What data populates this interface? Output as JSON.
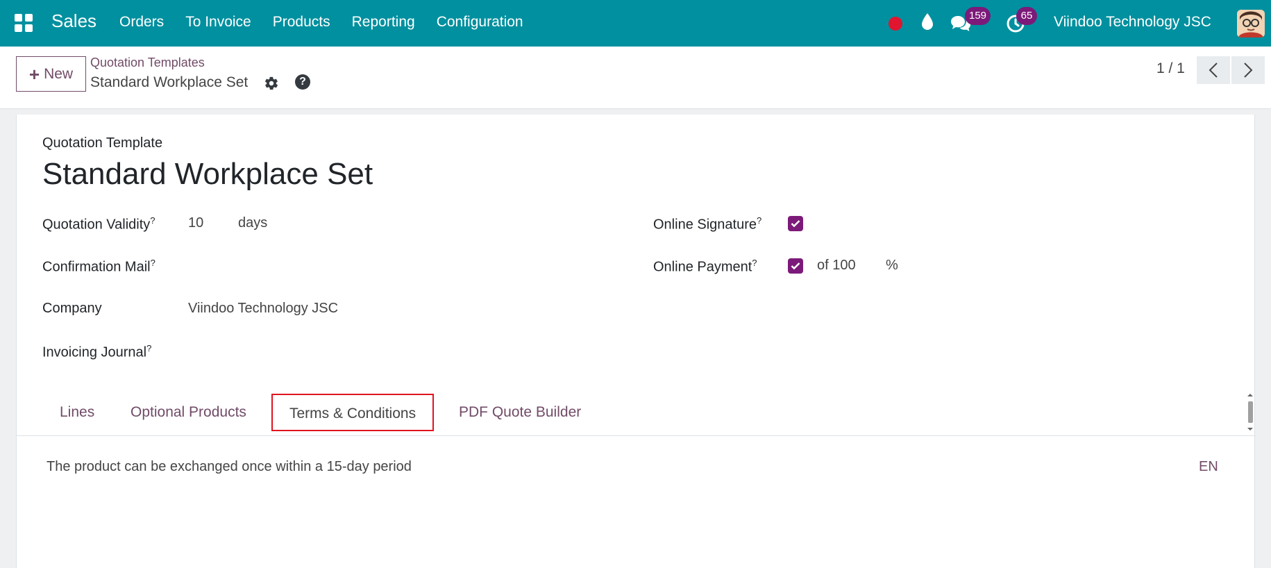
{
  "navbar": {
    "brand": "Sales",
    "menu": [
      "Orders",
      "To Invoice",
      "Products",
      "Reporting",
      "Configuration"
    ],
    "messages_count": "159",
    "activities_count": "65",
    "company": "Viindoo Technology JSC"
  },
  "control": {
    "new_label": "New",
    "breadcrumb_parent": "Quotation Templates",
    "breadcrumb_current": "Standard Workplace Set",
    "pager": "1 / 1"
  },
  "form": {
    "caption": "Quotation Template",
    "name": "Standard Workplace Set",
    "fields": {
      "validity_label": "Quotation Validity",
      "validity_value": "10",
      "validity_unit": "days",
      "confirmation_label": "Confirmation Mail",
      "company_label": "Company",
      "company_value": "Viindoo Technology JSC",
      "journal_label": "Invoicing Journal",
      "signature_label": "Online Signature",
      "payment_label": "Online Payment",
      "payment_of": "of 100",
      "payment_unit": "%"
    },
    "help_mark": "?"
  },
  "tabs": [
    "Lines",
    "Optional Products",
    "Terms & Conditions",
    "PDF Quote Builder"
  ],
  "active_tab": "Terms & Conditions",
  "terms": {
    "text": "The product can be exchanged once within a 15-day period",
    "lang": "EN"
  },
  "colors": {
    "navbar": "#00909f",
    "accent": "#714b67",
    "checkbox": "#7c1a79",
    "highlight": "#e0131f"
  }
}
